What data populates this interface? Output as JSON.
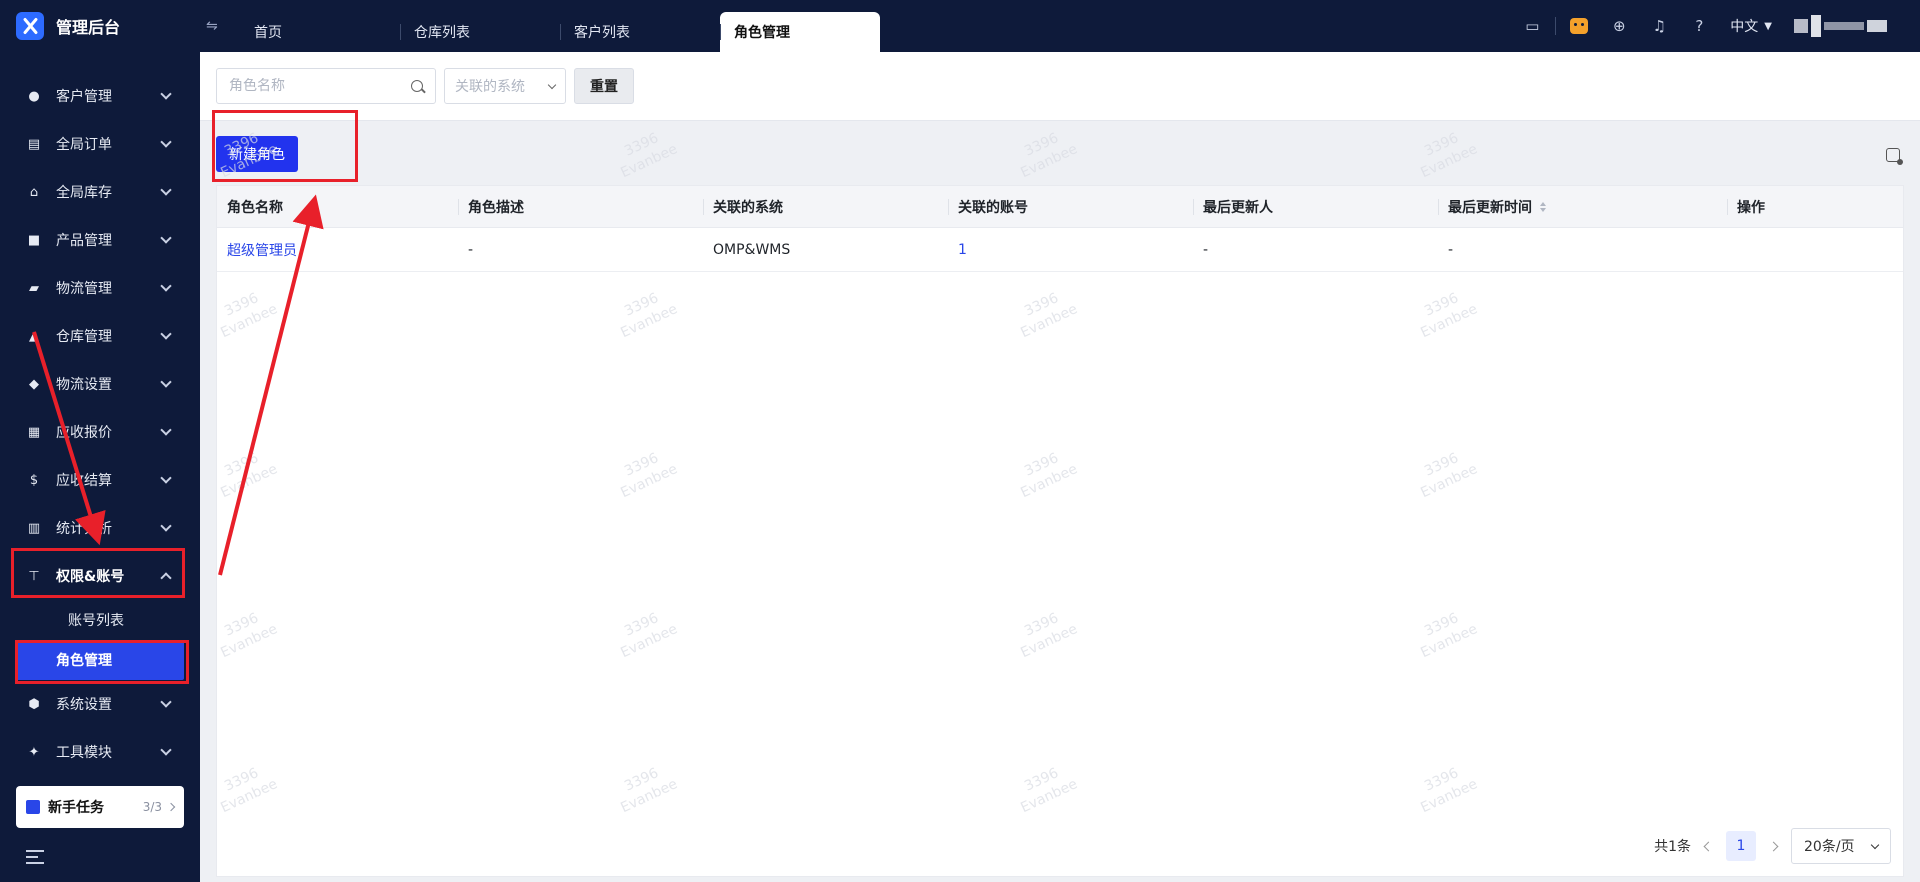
{
  "app": {
    "title": "管理后台"
  },
  "tabs": [
    {
      "label": "首页"
    },
    {
      "label": "仓库列表"
    },
    {
      "label": "客户列表"
    },
    {
      "label": "角色管理",
      "active": true
    }
  ],
  "header": {
    "lang": "中文"
  },
  "sidebar": {
    "items": [
      {
        "label": "客户管理",
        "icon": "users-icon"
      },
      {
        "label": "全局订单",
        "icon": "clipboard-icon"
      },
      {
        "label": "全局库存",
        "icon": "warehouse-icon"
      },
      {
        "label": "产品管理",
        "icon": "box-icon"
      },
      {
        "label": "物流管理",
        "icon": "truck-icon"
      },
      {
        "label": "仓库管理",
        "icon": "building-icon"
      },
      {
        "label": "物流设置",
        "icon": "package-settings-icon"
      },
      {
        "label": "应收报价",
        "icon": "document-icon"
      },
      {
        "label": "应收结算",
        "icon": "dollar-icon"
      },
      {
        "label": "统计分析",
        "icon": "chart-icon"
      },
      {
        "label": "权限&账号",
        "icon": "org-chart-icon",
        "open": true
      }
    ],
    "sub_items": [
      {
        "label": "账号列表"
      },
      {
        "label": "角色管理",
        "active": true
      }
    ],
    "items_after": [
      {
        "label": "系统设置",
        "icon": "hexagon-settings-icon"
      },
      {
        "label": "工具模块",
        "icon": "wrench-icon"
      }
    ],
    "newbie": {
      "label": "新手任务",
      "count": "3/3"
    }
  },
  "filters": {
    "search_placeholder": "角色名称",
    "system_placeholder": "关联的系统",
    "reset_label": "重置"
  },
  "toolbar": {
    "new_role_label": "新建角色"
  },
  "table": {
    "columns": [
      "角色名称",
      "角色描述",
      "关联的系统",
      "关联的账号",
      "最后更新人",
      "最后更新时间",
      "操作"
    ],
    "rows": [
      [
        "超级管理员",
        "-",
        "OMP&WMS",
        "1",
        "-",
        "-",
        ""
      ]
    ]
  },
  "pager": {
    "total": "共1条",
    "page": "1",
    "page_size": "20条/页"
  },
  "watermark": {
    "line1": "3396",
    "line2": "Evanbee"
  },
  "colors": {
    "nav_bg": "#0e1a3a",
    "primary": "#2233ee",
    "active_item": "#2946e8",
    "annotation": "#e8202a"
  }
}
